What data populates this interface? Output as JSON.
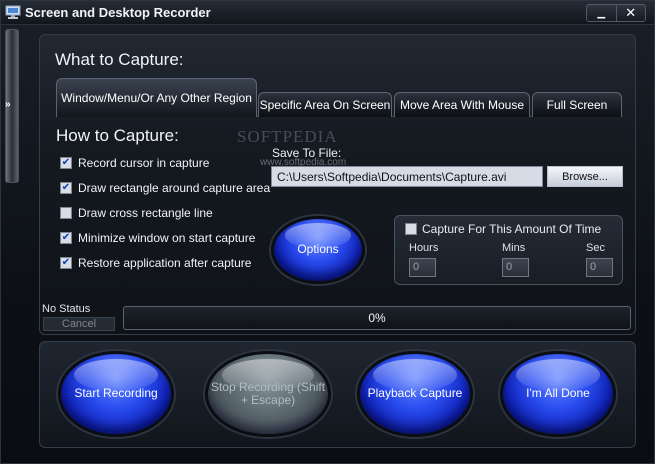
{
  "window": {
    "title": "Screen and Desktop Recorder",
    "minimize_glyph": "▁",
    "close_glyph": "✕"
  },
  "side": {
    "arrow": "»"
  },
  "what_to_capture": {
    "heading": "What to Capture:",
    "tabs": [
      {
        "label": "Window/Menu/Or Any Other Region",
        "active": true
      },
      {
        "label": "Specific Area On Screen",
        "active": false
      },
      {
        "label": "Move Area With Mouse",
        "active": false
      },
      {
        "label": "Full Screen",
        "active": false
      }
    ]
  },
  "how_to_capture": {
    "heading": "How to Capture:",
    "options": [
      {
        "label": "Record cursor in capture",
        "checked": true
      },
      {
        "label": "Draw rectangle around capture area",
        "checked": true
      },
      {
        "label": "Draw cross rectangle line",
        "checked": false
      },
      {
        "label": "Minimize window on start capture",
        "checked": true
      },
      {
        "label": "Restore application after capture",
        "checked": true
      }
    ]
  },
  "save": {
    "label": "Save To File:",
    "value": "C:\\Users\\Softpedia\\Documents\\Capture.avi",
    "browse_label": "Browse..."
  },
  "options_button": {
    "label": "Options"
  },
  "timer": {
    "label": "Capture For This Amount Of Time",
    "checked": false,
    "hours_label": "Hours",
    "mins_label": "Mins",
    "sec_label": "Sec",
    "hours": "0",
    "mins": "0",
    "sec": "0"
  },
  "status": {
    "text": "No Status",
    "cancel_label": "Cancel",
    "progress_text": "0%",
    "progress": 0
  },
  "actions": {
    "start": "Start Recording",
    "stop": "Stop Recording (Shift + Escape)",
    "playback": "Playback Capture",
    "done": "I'm All Done"
  },
  "watermark": {
    "brand": "SOFTPEDIA",
    "url": "www.softpedia.com"
  },
  "colors": {
    "orb_blue": "#2b4ef0",
    "orb_disabled": "#5e6a72",
    "background": "#0d1117"
  }
}
